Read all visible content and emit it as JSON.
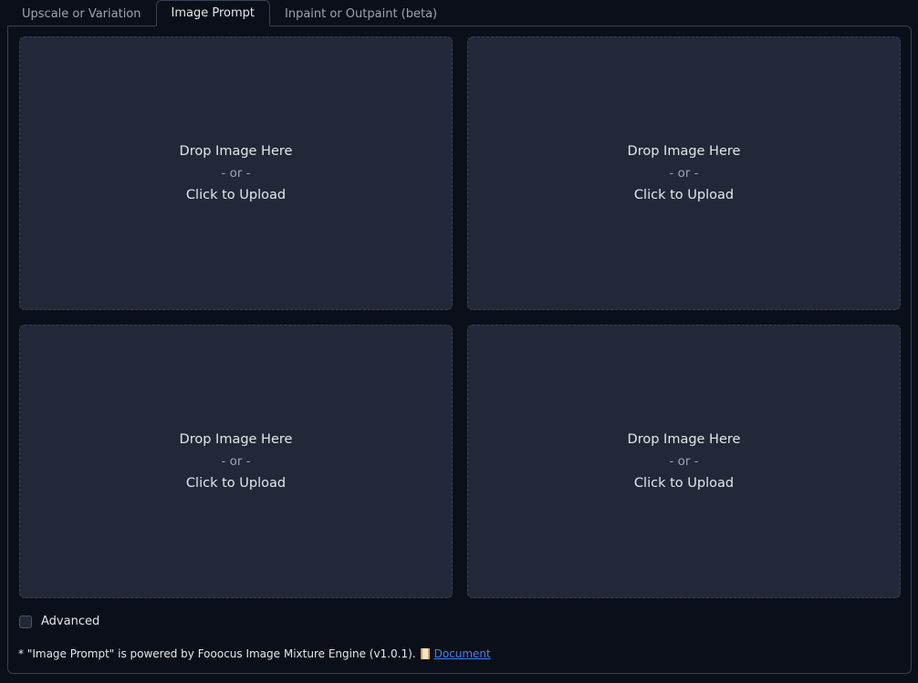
{
  "tabs": [
    {
      "label": "Upscale or Variation",
      "selected": false
    },
    {
      "label": "Image Prompt",
      "selected": true
    },
    {
      "label": "Inpaint or Outpaint (beta)",
      "selected": false
    }
  ],
  "dropzone": {
    "line1": "Drop Image Here",
    "line2": "- or -",
    "line3": "Click to Upload"
  },
  "advanced": {
    "label": "Advanced",
    "checked": false
  },
  "footnote": {
    "text": "* \"Image Prompt\" is powered by Fooocus Image Mixture Engine (v1.0.1).",
    "icon": "scroll-icon",
    "link_label": "Document"
  },
  "colors": {
    "background": "#0b0f19",
    "dropzone": "#222838",
    "border": "#374151",
    "link": "#3b82f6"
  }
}
